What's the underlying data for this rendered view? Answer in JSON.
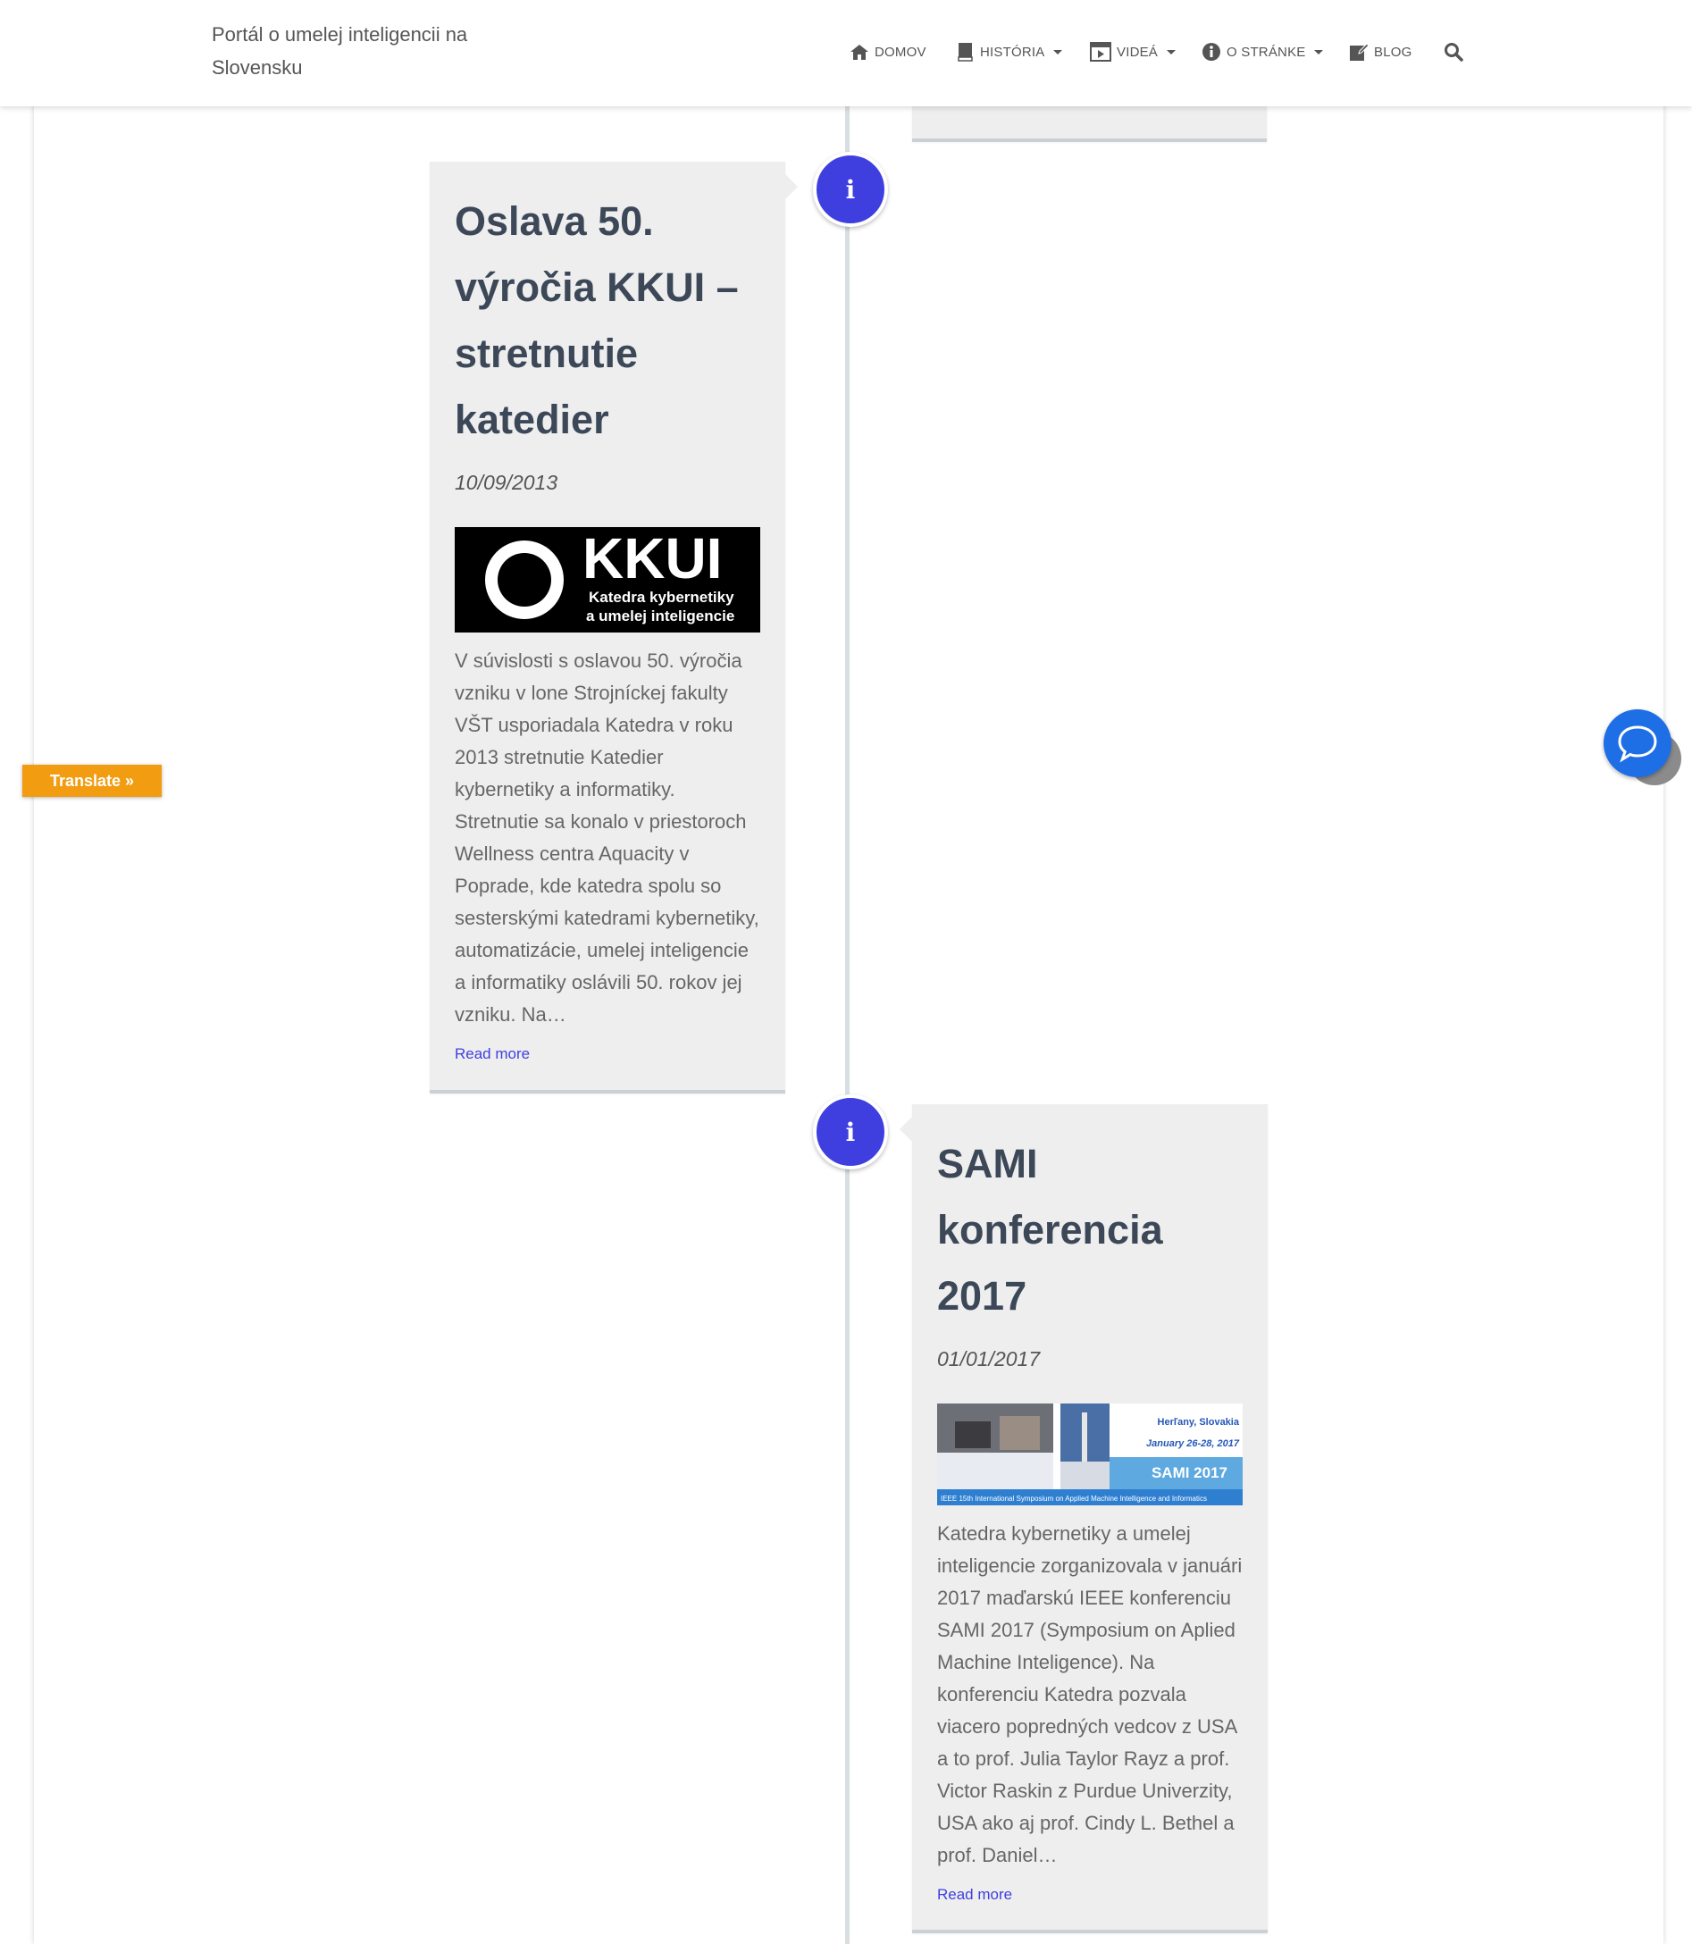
{
  "header": {
    "brand": "Portál o umelej inteligencii na Slovensku",
    "menu": [
      {
        "label": "DOMOV",
        "icon": "home-icon"
      },
      {
        "label": "HISTÓRIA",
        "icon": "book-icon",
        "dropdown": true
      },
      {
        "label": "VIDEÁ",
        "icon": "video-icon",
        "dropdown": true
      },
      {
        "label": "O STRÁNKE",
        "icon": "info-icon",
        "dropdown": true
      },
      {
        "label": "BLOG",
        "icon": "edit-icon"
      }
    ],
    "search_icon": "search-icon"
  },
  "timeline": {
    "accent_color": "#3f3fe0",
    "entries": [
      {
        "title": "Oslava 50. výročia KKUI – stretnutie katedier",
        "date": "10/09/2013",
        "image": {
          "logo_text": "KKUI",
          "subtitle_line1": "Katedra kybernetiky",
          "subtitle_line2": "a umelej inteligencie"
        },
        "excerpt": "V súvislosti s oslavou 50. výročia vzniku v lone Strojníckej fakulty VŠT usporiadala Katedra v roku 2013 stretnutie Katedier kybernetiky a informatiky. Stretnutie sa konalo v priestoroch Wellness centra Aquacity v Poprade, kde katedra spolu so sesterskými katedrami kybernetiky, automatizácie, umelej inteligencie a informatiky oslávili 50. rokov jej vzniku. Na…",
        "read_more": "Read more"
      },
      {
        "title": "SAMI konferencia 2017",
        "date": "01/01/2017",
        "image": {
          "location": "Herľany, Slovakia",
          "dates": "January 26-28, 2017",
          "name": "SAMI 2017",
          "caption": "IEEE 15th International Symposium on Applied Machine Intelligence and Informatics"
        },
        "excerpt": "Katedra kybernetiky a umelej inteligencie zorganizovala v januári 2017 maďarskú IEEE konferenciu SAMI 2017 (Symposium on Aplied Machine Inteligence). Na konferenciu Katedra pozvala viacero popredných vedcov z USA a to prof. Julia Taylor Rayz a prof. Victor Raskin z Purdue Univerzity, USA ako aj prof. Cindy L. Bethel a prof. Daniel…",
        "read_more": "Read more"
      }
    ]
  },
  "widgets": {
    "translate_label": "Translate »",
    "chat_icon": "chat-icon"
  }
}
